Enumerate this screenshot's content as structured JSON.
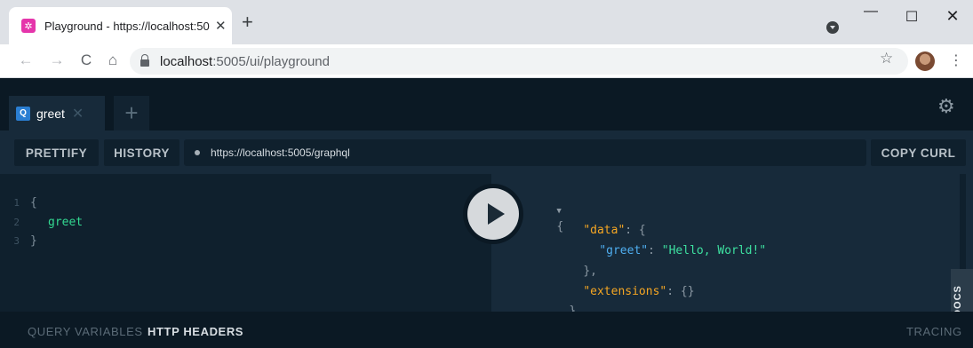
{
  "browser": {
    "tab_title": "Playground - https://localhost:50",
    "tab_close": "✕",
    "new_tab": "+",
    "window_controls": {
      "minimize": "—",
      "maximize": "☐",
      "close": "✕"
    },
    "nav": {
      "back": "←",
      "forward": "→",
      "reload": "C",
      "home": "⌂"
    },
    "address_host": "localhost",
    "address_path": ":5005/ui/playground",
    "bookmark_icon": "☆",
    "menu_icon": "⋮"
  },
  "playground": {
    "tabs": [
      {
        "badge": "Q",
        "label": "greet",
        "close": "✕"
      }
    ],
    "add_tab": "+",
    "settings_icon": "⚙",
    "toolbar": {
      "prettify": "PRETTIFY",
      "history": "HISTORY",
      "endpoint": "https://localhost:5005/graphql",
      "copy_curl": "COPY CURL"
    },
    "editor": {
      "lines": [
        {
          "num": "1",
          "text": "{"
        },
        {
          "num": "2",
          "text": "greet"
        },
        {
          "num": "3",
          "text": "}"
        }
      ]
    },
    "result": {
      "open": "{",
      "fold_marker": "▼",
      "data_key": "\"data\"",
      "data_open": ": {",
      "greet_key": "\"greet\"",
      "greet_sep": ": ",
      "greet_value": "\"Hello, World!\"",
      "data_close": "},",
      "extensions_key": "\"extensions\"",
      "extensions_value": ": {}",
      "close": "}"
    },
    "docs_label": "DOCS",
    "bottom": {
      "query_variables": "QUERY VARIABLES",
      "http_headers": "HTTP HEADERS",
      "tracing": "TRACING"
    }
  },
  "colors": {
    "graphql_pink": "#e535ab",
    "field_green": "#33d891",
    "key_orange": "#f5a623",
    "key_blue": "#4faef0"
  }
}
